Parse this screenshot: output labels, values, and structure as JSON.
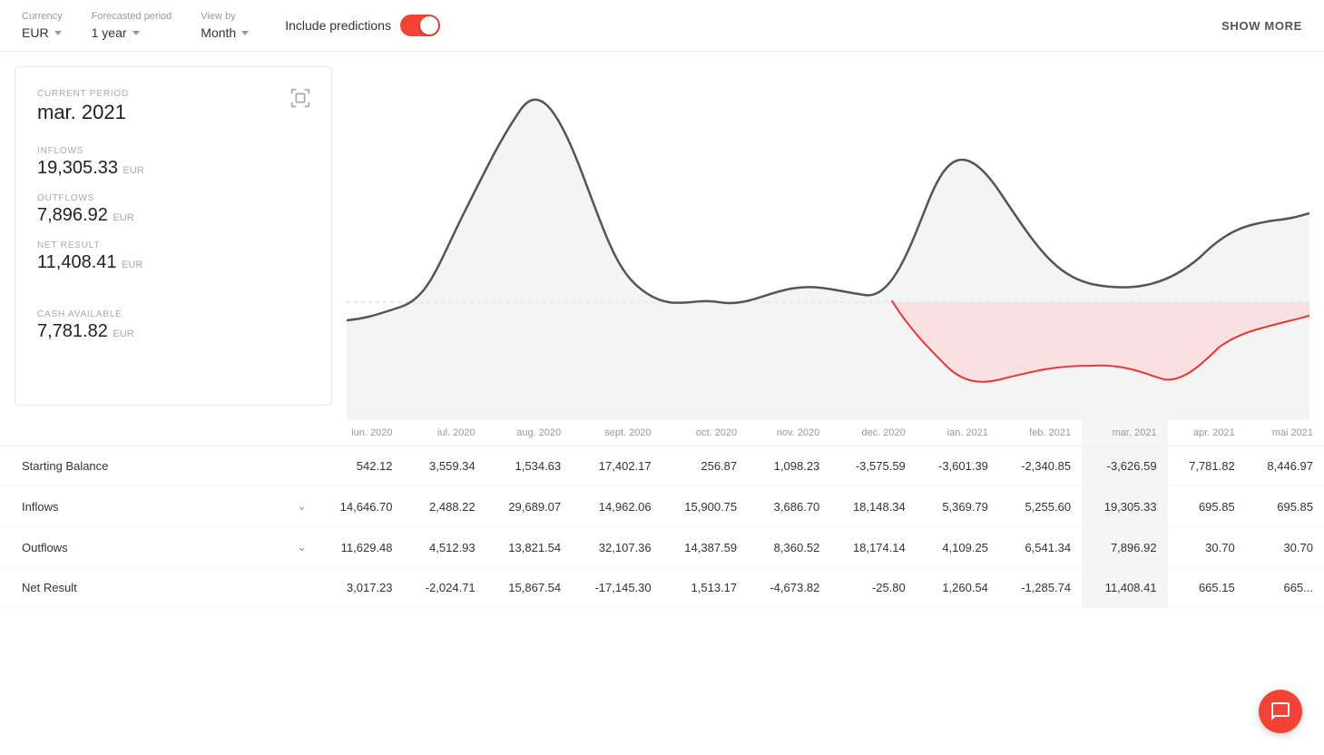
{
  "toolbar": {
    "currency_label": "Currency",
    "currency_value": "EUR",
    "forecasted_label": "Forecasted period",
    "forecasted_value": "1 year",
    "viewby_label": "View by",
    "viewby_value": "Month",
    "predictions_label": "Include predictions",
    "show_more_label": "SHOW MORE"
  },
  "left_panel": {
    "period_label": "CURRENT PERIOD",
    "period_value": "mar. 2021",
    "inflows_label": "INFLOWS",
    "inflows_value": "19,305.33",
    "inflows_currency": "EUR",
    "outflows_label": "OUTFLOWS",
    "outflows_value": "7,896.92",
    "outflows_currency": "EUR",
    "net_result_label": "NET RESULT",
    "net_result_value": "11,408.41",
    "net_result_currency": "EUR",
    "cash_label": "CASH AVAILABLE",
    "cash_value": "7,781.82",
    "cash_currency": "EUR"
  },
  "table": {
    "columns": [
      "",
      "iun. 2020",
      "iul. 2020",
      "aug. 2020",
      "sept. 2020",
      "oct. 2020",
      "nov. 2020",
      "dec. 2020",
      "ian. 2021",
      "feb. 2021",
      "mar. 2021",
      "apr. 2021",
      "mai 2021"
    ],
    "rows": [
      {
        "label": "Starting Balance",
        "expandable": false,
        "values": [
          "542.12",
          "3,559.34",
          "1,534.63",
          "17,402.17",
          "256.87",
          "1,098.23",
          "-3,575.59",
          "-3,601.39",
          "-2,340.85",
          "-3,626.59",
          "7,781.82",
          "8,446.97"
        ]
      },
      {
        "label": "Inflows",
        "expandable": true,
        "values": [
          "14,646.70",
          "2,488.22",
          "29,689.07",
          "14,962.06",
          "15,900.75",
          "3,686.70",
          "18,148.34",
          "5,369.79",
          "5,255.60",
          "19,305.33",
          "695.85",
          "695.85"
        ]
      },
      {
        "label": "Outflows",
        "expandable": true,
        "values": [
          "11,629.48",
          "4,512.93",
          "13,821.54",
          "32,107.36",
          "14,387.59",
          "8,360.52",
          "18,174.14",
          "4,109.25",
          "6,541.34",
          "7,896.92",
          "30.70",
          "30.70"
        ]
      },
      {
        "label": "Net Result",
        "expandable": false,
        "values": [
          "3,017.23",
          "-2,024.71",
          "15,867.54",
          "-17,145.30",
          "1,513.17",
          "-4,673.82",
          "-25.80",
          "1,260.54",
          "-1,285.74",
          "11,408.41",
          "665.15",
          "665..."
        ]
      }
    ]
  }
}
